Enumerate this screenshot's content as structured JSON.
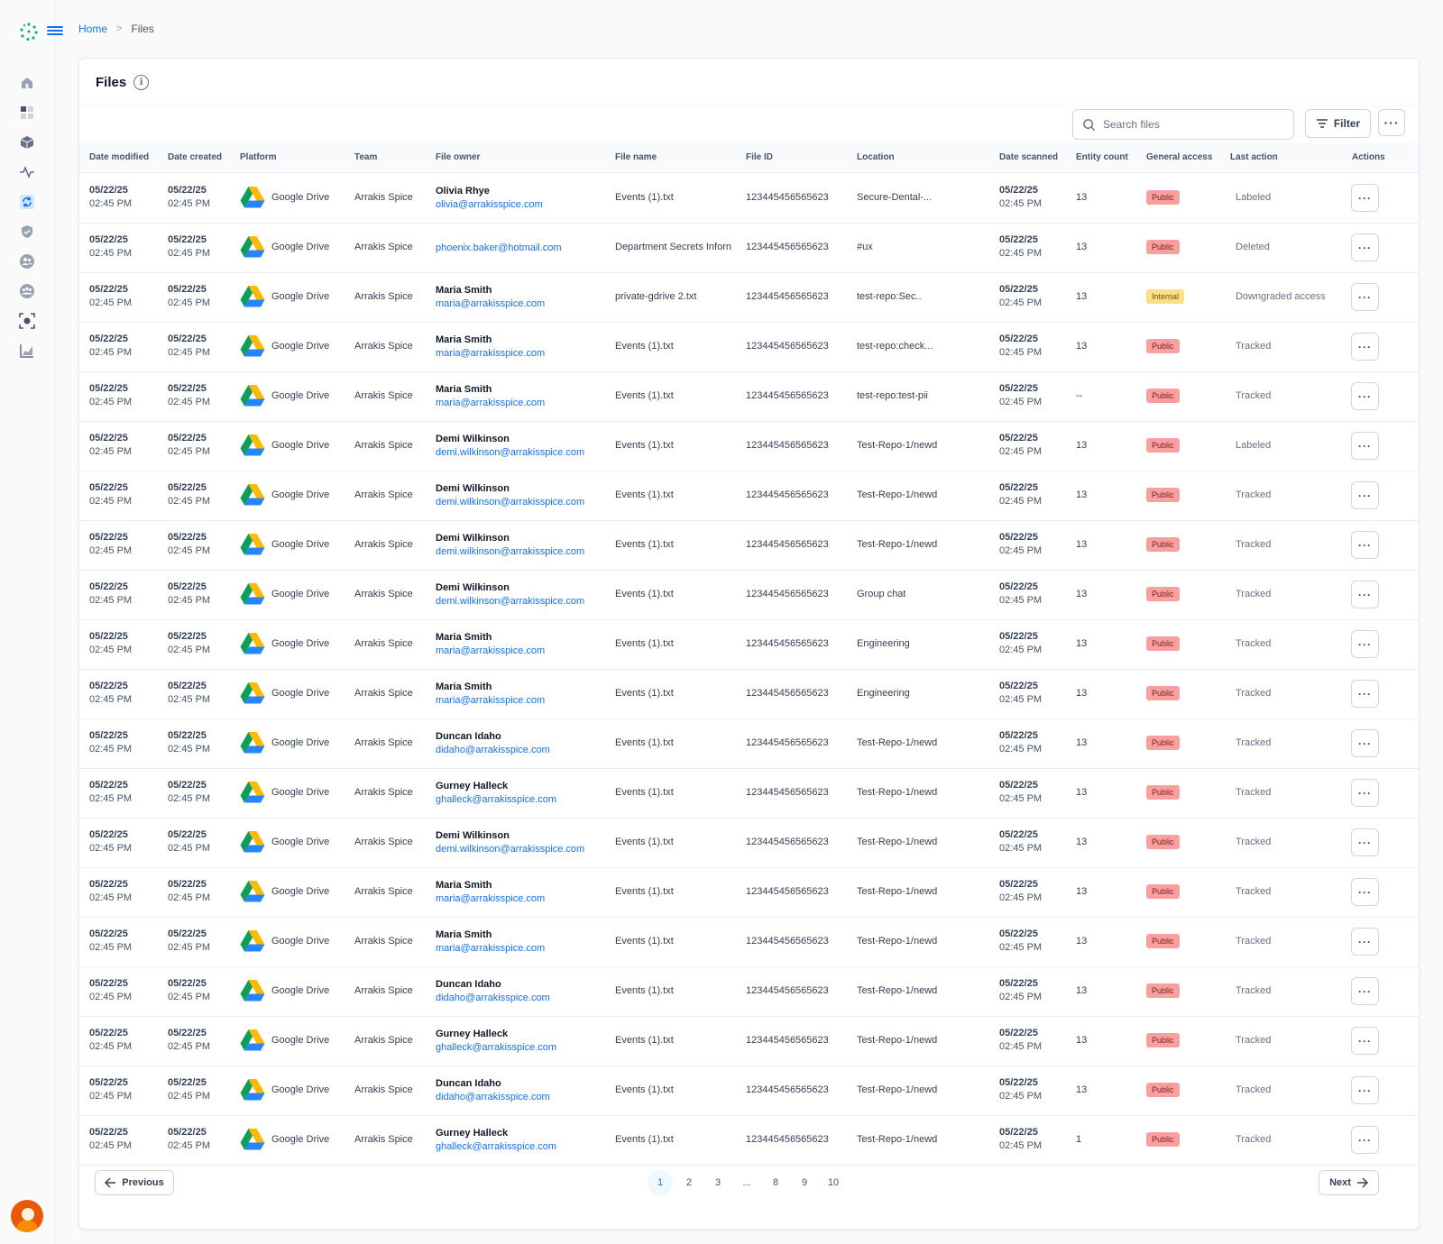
{
  "breadcrumb": {
    "home": "Home",
    "current": "Files"
  },
  "page": {
    "title": "Files",
    "info": "i"
  },
  "search": {
    "placeholder": "Search files"
  },
  "toolbar": {
    "filter_label": "Filter",
    "more_label": "···"
  },
  "columns": [
    "Date modified",
    "Date created",
    "Platform",
    "Team",
    "File owner",
    "File name",
    "File ID",
    "Location",
    "Date scanned",
    "Entity count",
    "General access",
    "Last action",
    "Actions"
  ],
  "rows": [
    {
      "modified_date": "05/22/25",
      "modified_time": "02:45 PM",
      "created_date": "05/22/25",
      "created_time": "02:45 PM",
      "platform": "Google Drive",
      "team": "Arrakis Spice",
      "owner_name": "Olivia Rhye",
      "owner_email": "olivia@arrakisspice.com",
      "file_name": "Events (1).txt",
      "file_id": "123445456565623",
      "location": "Secure-Dental-...",
      "scanned_date": "05/22/25",
      "scanned_time": "02:45 PM",
      "entity_count": "13",
      "access": "Public",
      "last_action": "Labeled",
      "action_label": "···"
    },
    {
      "modified_date": "05/22/25",
      "modified_time": "02:45 PM",
      "created_date": "05/22/25",
      "created_time": "02:45 PM",
      "platform": "Google Drive",
      "team": "Arrakis Spice",
      "owner_name": "",
      "owner_email": "phoenix.baker@hotmail.com",
      "file_name": "Department Secrets Inforn",
      "file_id": "123445456565623",
      "location": "#ux",
      "scanned_date": "05/22/25",
      "scanned_time": "02:45 PM",
      "entity_count": "13",
      "access": "Public",
      "last_action": "Deleted",
      "action_label": "···"
    },
    {
      "modified_date": "05/22/25",
      "modified_time": "02:45 PM",
      "created_date": "05/22/25",
      "created_time": "02:45 PM",
      "platform": "Google Drive",
      "team": "Arrakis Spice",
      "owner_name": "Maria Smith",
      "owner_email": "maria@arrakisspice.com",
      "file_name": "private-gdrive 2.txt",
      "file_id": "123445456565623",
      "location": "test-repo:Sec..",
      "scanned_date": "05/22/25",
      "scanned_time": "02:45 PM",
      "entity_count": "13",
      "access": "Internal",
      "last_action": "Downgraded access",
      "action_label": "···"
    },
    {
      "modified_date": "05/22/25",
      "modified_time": "02:45 PM",
      "created_date": "05/22/25",
      "created_time": "02:45 PM",
      "platform": "Google Drive",
      "team": "Arrakis Spice",
      "owner_name": "Maria Smith",
      "owner_email": "maria@arrakisspice.com",
      "file_name": "Events (1).txt",
      "file_id": "123445456565623",
      "location": "test-repo:check...",
      "scanned_date": "05/22/25",
      "scanned_time": "02:45 PM",
      "entity_count": "13",
      "access": "Public",
      "last_action": "Tracked",
      "action_label": "···"
    },
    {
      "modified_date": "05/22/25",
      "modified_time": "02:45 PM",
      "created_date": "05/22/25",
      "created_time": "02:45 PM",
      "platform": "Google Drive",
      "team": "Arrakis Spice",
      "owner_name": "Maria Smith",
      "owner_email": "maria@arrakisspice.com",
      "file_name": "Events (1).txt",
      "file_id": "123445456565623",
      "location": "test-repo:test-pii",
      "scanned_date": "05/22/25",
      "scanned_time": "02:45 PM",
      "entity_count": "--",
      "access": "Public",
      "last_action": "Tracked",
      "action_label": "···"
    },
    {
      "modified_date": "05/22/25",
      "modified_time": "02:45 PM",
      "created_date": "05/22/25",
      "created_time": "02:45 PM",
      "platform": "Google Drive",
      "team": "Arrakis Spice",
      "owner_name": "Demi Wilkinson",
      "owner_email": "demi.wilkinson@arrakisspice.com",
      "file_name": "Events (1).txt",
      "file_id": "123445456565623",
      "location": "Test-Repo-1/newd",
      "scanned_date": "05/22/25",
      "scanned_time": "02:45 PM",
      "entity_count": "13",
      "access": "Public",
      "last_action": "Labeled",
      "action_label": "···"
    },
    {
      "modified_date": "05/22/25",
      "modified_time": "02:45 PM",
      "created_date": "05/22/25",
      "created_time": "02:45 PM",
      "platform": "Google Drive",
      "team": "Arrakis Spice",
      "owner_name": "Demi Wilkinson",
      "owner_email": "demi.wilkinson@arrakisspice.com",
      "file_name": "Events (1).txt",
      "file_id": "123445456565623",
      "location": "Test-Repo-1/newd",
      "scanned_date": "05/22/25",
      "scanned_time": "02:45 PM",
      "entity_count": "13",
      "access": "Public",
      "last_action": "Tracked",
      "action_label": "···"
    },
    {
      "modified_date": "05/22/25",
      "modified_time": "02:45 PM",
      "created_date": "05/22/25",
      "created_time": "02:45 PM",
      "platform": "Google Drive",
      "team": "Arrakis Spice",
      "owner_name": "Demi Wilkinson",
      "owner_email": "demi.wilkinson@arrakisspice.com",
      "file_name": "Events (1).txt",
      "file_id": "123445456565623",
      "location": "Test-Repo-1/newd",
      "scanned_date": "05/22/25",
      "scanned_time": "02:45 PM",
      "entity_count": "13",
      "access": "Public",
      "last_action": "Tracked",
      "action_label": "···"
    },
    {
      "modified_date": "05/22/25",
      "modified_time": "02:45 PM",
      "created_date": "05/22/25",
      "created_time": "02:45 PM",
      "platform": "Google Drive",
      "team": "Arrakis Spice",
      "owner_name": "Demi Wilkinson",
      "owner_email": "demi.wilkinson@arrakisspice.com",
      "file_name": "Events (1).txt",
      "file_id": "123445456565623",
      "location": "Group chat",
      "scanned_date": "05/22/25",
      "scanned_time": "02:45 PM",
      "entity_count": "13",
      "access": "Public",
      "last_action": "Tracked",
      "action_label": "···"
    },
    {
      "modified_date": "05/22/25",
      "modified_time": "02:45 PM",
      "created_date": "05/22/25",
      "created_time": "02:45 PM",
      "platform": "Google Drive",
      "team": "Arrakis Spice",
      "owner_name": "Maria Smith",
      "owner_email": "maria@arrakisspice.com",
      "file_name": "Events (1).txt",
      "file_id": "123445456565623",
      "location": "Engineering",
      "scanned_date": "05/22/25",
      "scanned_time": "02:45 PM",
      "entity_count": "13",
      "access": "Public",
      "last_action": "Tracked",
      "action_label": "···"
    },
    {
      "modified_date": "05/22/25",
      "modified_time": "02:45 PM",
      "created_date": "05/22/25",
      "created_time": "02:45 PM",
      "platform": "Google Drive",
      "team": "Arrakis Spice",
      "owner_name": "Maria Smith",
      "owner_email": "maria@arrakisspice.com",
      "file_name": "Events (1).txt",
      "file_id": "123445456565623",
      "location": "Engineering",
      "scanned_date": "05/22/25",
      "scanned_time": "02:45 PM",
      "entity_count": "13",
      "access": "Public",
      "last_action": "Tracked",
      "action_label": "···"
    },
    {
      "modified_date": "05/22/25",
      "modified_time": "02:45 PM",
      "created_date": "05/22/25",
      "created_time": "02:45 PM",
      "platform": "Google Drive",
      "team": "Arrakis Spice",
      "owner_name": "Duncan Idaho",
      "owner_email": "didaho@arrakisspice.com",
      "file_name": "Events (1).txt",
      "file_id": "123445456565623",
      "location": "Test-Repo-1/newd",
      "scanned_date": "05/22/25",
      "scanned_time": "02:45 PM",
      "entity_count": "13",
      "access": "Public",
      "last_action": "Tracked",
      "action_label": "···"
    },
    {
      "modified_date": "05/22/25",
      "modified_time": "02:45 PM",
      "created_date": "05/22/25",
      "created_time": "02:45 PM",
      "platform": "Google Drive",
      "team": "Arrakis Spice",
      "owner_name": "Gurney Halleck",
      "owner_email": "ghalleck@arrakisspice.com",
      "file_name": "Events (1).txt",
      "file_id": "123445456565623",
      "location": "Test-Repo-1/newd",
      "scanned_date": "05/22/25",
      "scanned_time": "02:45 PM",
      "entity_count": "13",
      "access": "Public",
      "last_action": "Tracked",
      "action_label": "···"
    },
    {
      "modified_date": "05/22/25",
      "modified_time": "02:45 PM",
      "created_date": "05/22/25",
      "created_time": "02:45 PM",
      "platform": "Google Drive",
      "team": "Arrakis Spice",
      "owner_name": "Demi Wilkinson",
      "owner_email": "demi.wilkinson@arrakisspice.com",
      "file_name": "Events (1).txt",
      "file_id": "123445456565623",
      "location": "Test-Repo-1/newd",
      "scanned_date": "05/22/25",
      "scanned_time": "02:45 PM",
      "entity_count": "13",
      "access": "Public",
      "last_action": "Tracked",
      "action_label": "···"
    },
    {
      "modified_date": "05/22/25",
      "modified_time": "02:45 PM",
      "created_date": "05/22/25",
      "created_time": "02:45 PM",
      "platform": "Google Drive",
      "team": "Arrakis Spice",
      "owner_name": "Maria Smith",
      "owner_email": "maria@arrakisspice.com",
      "file_name": "Events (1).txt",
      "file_id": "123445456565623",
      "location": "Test-Repo-1/newd",
      "scanned_date": "05/22/25",
      "scanned_time": "02:45 PM",
      "entity_count": "13",
      "access": "Public",
      "last_action": "Tracked",
      "action_label": "···"
    },
    {
      "modified_date": "05/22/25",
      "modified_time": "02:45 PM",
      "created_date": "05/22/25",
      "created_time": "02:45 PM",
      "platform": "Google Drive",
      "team": "Arrakis Spice",
      "owner_name": "Maria Smith",
      "owner_email": "maria@arrakisspice.com",
      "file_name": "Events (1).txt",
      "file_id": "123445456565623",
      "location": "Test-Repo-1/newd",
      "scanned_date": "05/22/25",
      "scanned_time": "02:45 PM",
      "entity_count": "13",
      "access": "Public",
      "last_action": "Tracked",
      "action_label": "···"
    },
    {
      "modified_date": "05/22/25",
      "modified_time": "02:45 PM",
      "created_date": "05/22/25",
      "created_time": "02:45 PM",
      "platform": "Google Drive",
      "team": "Arrakis Spice",
      "owner_name": "Duncan Idaho",
      "owner_email": "didaho@arrakisspice.com",
      "file_name": "Events (1).txt",
      "file_id": "123445456565623",
      "location": "Test-Repo-1/newd",
      "scanned_date": "05/22/25",
      "scanned_time": "02:45 PM",
      "entity_count": "13",
      "access": "Public",
      "last_action": "Tracked",
      "action_label": "···"
    },
    {
      "modified_date": "05/22/25",
      "modified_time": "02:45 PM",
      "created_date": "05/22/25",
      "created_time": "02:45 PM",
      "platform": "Google Drive",
      "team": "Arrakis Spice",
      "owner_name": "Gurney Halleck",
      "owner_email": "ghalleck@arrakisspice.com",
      "file_name": "Events (1).txt",
      "file_id": "123445456565623",
      "location": "Test-Repo-1/newd",
      "scanned_date": "05/22/25",
      "scanned_time": "02:45 PM",
      "entity_count": "13",
      "access": "Public",
      "last_action": "Tracked",
      "action_label": "···"
    },
    {
      "modified_date": "05/22/25",
      "modified_time": "02:45 PM",
      "created_date": "05/22/25",
      "created_time": "02:45 PM",
      "platform": "Google Drive",
      "team": "Arrakis Spice",
      "owner_name": "Duncan Idaho",
      "owner_email": "didaho@arrakisspice.com",
      "file_name": "Events (1).txt",
      "file_id": "123445456565623",
      "location": "Test-Repo-1/newd",
      "scanned_date": "05/22/25",
      "scanned_time": "02:45 PM",
      "entity_count": "13",
      "access": "Public",
      "last_action": "Tracked",
      "action_label": "···"
    },
    {
      "modified_date": "05/22/25",
      "modified_time": "02:45 PM",
      "created_date": "05/22/25",
      "created_time": "02:45 PM",
      "platform": "Google Drive",
      "team": "Arrakis Spice",
      "owner_name": "Gurney Halleck",
      "owner_email": "ghalleck@arrakisspice.com",
      "file_name": "Events (1).txt",
      "file_id": "123445456565623",
      "location": "Test-Repo-1/newd",
      "scanned_date": "05/22/25",
      "scanned_time": "02:45 PM",
      "entity_count": "1",
      "access": "Public",
      "last_action": "Tracked",
      "action_label": "···"
    }
  ],
  "pagination": {
    "previous_label": "Previous",
    "next_label": "Next",
    "pages": [
      "1",
      "2",
      "3",
      "...",
      "8",
      "9",
      "10"
    ],
    "current_page": "1"
  },
  "sidebar": {
    "icons": [
      "home-icon",
      "dashboard-icon",
      "cube-icon",
      "activity-icon",
      "sync-icon",
      "shield-check-icon",
      "users-icon",
      "team-icon",
      "scan-icon",
      "chart-icon"
    ]
  },
  "colors": {
    "accent": "#1570ef",
    "public_badge": "#f8a0a0",
    "internal_badge": "#fedf89"
  }
}
